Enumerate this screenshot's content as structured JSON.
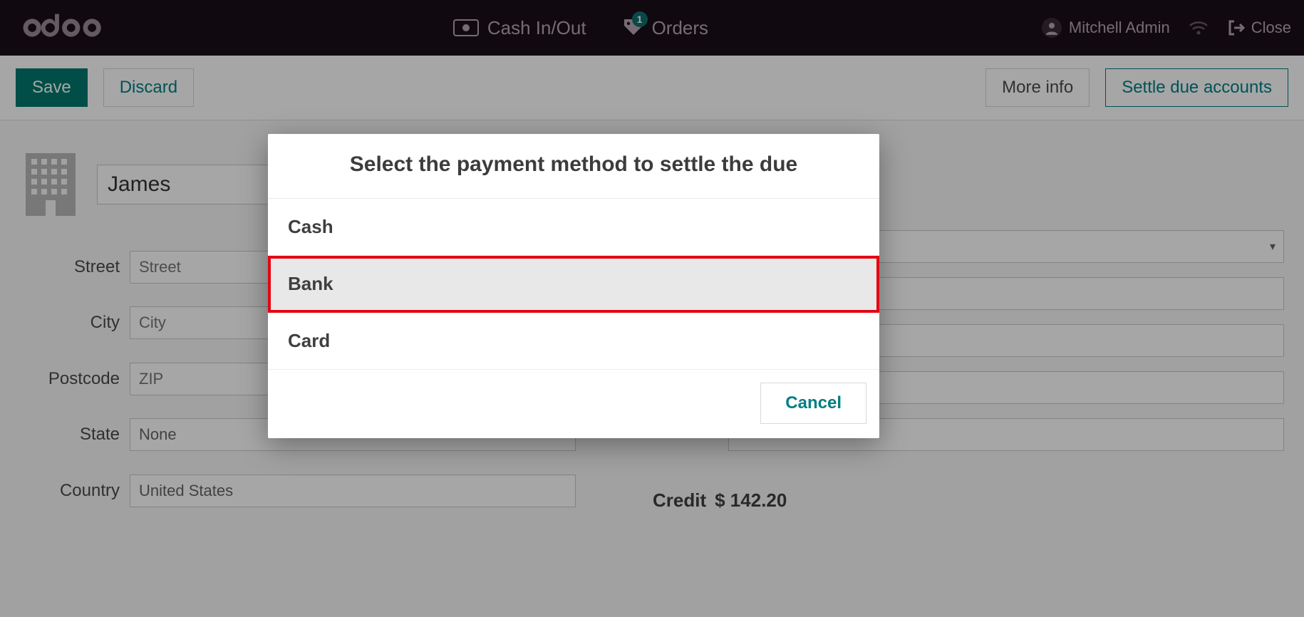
{
  "header": {
    "cash_in_out_label": "Cash In/Out",
    "orders_label": "Orders",
    "orders_badge": "1",
    "user_name": "Mitchell Admin",
    "close_label": "Close"
  },
  "action_bar": {
    "save_label": "Save",
    "discard_label": "Discard",
    "more_info_label": "More info",
    "settle_due_label": "Settle due accounts"
  },
  "partner": {
    "name_value": "James",
    "labels": {
      "street": "Street",
      "city": "City",
      "postcode": "Postcode",
      "state": "State",
      "country": "Country"
    },
    "placeholders": {
      "street": "Street",
      "city": "City",
      "postcode": "ZIP"
    },
    "state_value": "None",
    "country_value": "United States"
  },
  "right_col": {
    "placeholder_empty": ""
  },
  "credit": {
    "label": "Credit",
    "value": "$ 142.20"
  },
  "modal": {
    "title": "Select the payment method to settle the due",
    "methods": [
      "Cash",
      "Bank",
      "Card"
    ],
    "highlighted_index": 1,
    "cancel_label": "Cancel"
  }
}
